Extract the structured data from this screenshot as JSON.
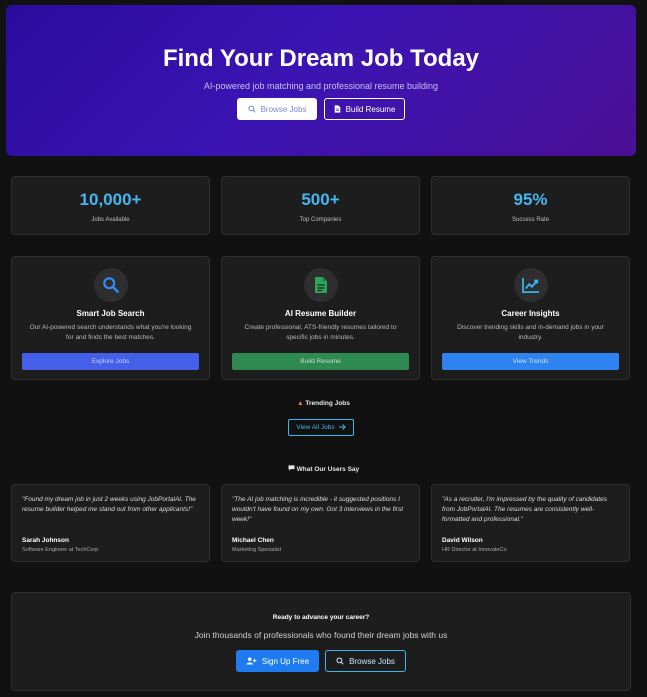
{
  "hero": {
    "title": "Find Your Dream Job Today",
    "subtitle": "AI-powered job matching and professional resume building",
    "browse_label": "Browse Jobs",
    "build_label": "Build Resume",
    "gradient_colors": [
      "#2a0c9e",
      "#4a1095"
    ]
  },
  "stats": [
    {
      "value": "10,000+",
      "label": "Jobs Available"
    },
    {
      "value": "500+",
      "label": "Top Companies"
    },
    {
      "value": "95%",
      "label": "Success Rate"
    }
  ],
  "features": [
    {
      "icon": "search-icon",
      "title": "Smart Job Search",
      "description": "Our AI-powered search understands what you're looking for and finds the best matches.",
      "button_label": "Explore Jobs",
      "button_color": "#4560e8"
    },
    {
      "icon": "document-icon",
      "title": "AI Resume Builder",
      "description": "Create professional, ATS-friendly resumes tailored to specific jobs in minutes.",
      "button_label": "Build Resume",
      "button_color": "#2f8a52"
    },
    {
      "icon": "chart-line-icon",
      "title": "Career Insights",
      "description": "Discover trending skills and in-demand jobs in your industry.",
      "button_label": "View Trends",
      "button_color": "#2f83f0"
    }
  ],
  "trending": {
    "heading": "Trending Jobs",
    "icon": "fire-icon",
    "view_all_label": "View All Jobs"
  },
  "testimonials": {
    "heading": "What Our Users Say",
    "icon": "speech-bubble-icon",
    "items": [
      {
        "quote": "\"Found my dream job in just 2 weeks using JobPortalAI. The resume builder helped me stand out from other applicants!\"",
        "name": "Sarah Johnson",
        "role": "Software Engineer at TechCorp"
      },
      {
        "quote": "\"The AI job matching is incredible - it suggested positions I wouldn't have found on my own. Got 3 interviews in the first week!\"",
        "name": "Michael Chen",
        "role": "Marketing Specialist"
      },
      {
        "quote": "\"As a recruiter, I'm impressed by the quality of candidates from JobPortalAI. The resumes are consistently well-formatted and professional.\"",
        "name": "David Wilson",
        "role": "HR Director at InnovateCo"
      }
    ]
  },
  "cta": {
    "title": "Ready to advance your career?",
    "subtitle": "Join thousands of professionals who found their dream jobs with us",
    "signup_label": "Sign Up Free",
    "browse_label": "Browse Jobs"
  },
  "colors": {
    "background": "#111111",
    "card": "#1d1d1d",
    "accent_cyan": "#46b6f0",
    "accent_blue": "#1f7cf0"
  }
}
